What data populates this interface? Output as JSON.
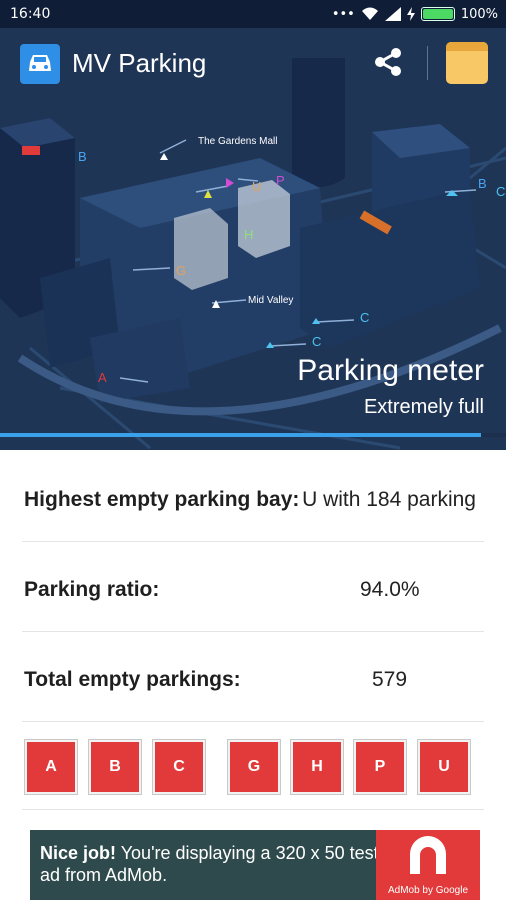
{
  "status_bar": {
    "time": "16:40",
    "icons": [
      "dots-icon",
      "wifi-icon",
      "signal-icon",
      "charging-icon",
      "battery-icon"
    ],
    "battery_percent": "100%"
  },
  "app_bar": {
    "title": "MV Parking",
    "app_icon": "car-icon",
    "actions": [
      "share-icon",
      "notes-icon"
    ]
  },
  "map": {
    "mall_labels": [
      "The Gardens Mall",
      "Mid Valley"
    ],
    "zone_labels": [
      {
        "id": "A",
        "color": "#e03a3a"
      },
      {
        "id": "B",
        "color": "#4aa3f0"
      },
      {
        "id": "B",
        "color": "#4aa3f0"
      },
      {
        "id": "C",
        "color": "#4cc3f0"
      },
      {
        "id": "C",
        "color": "#4cc3f0"
      },
      {
        "id": "C",
        "color": "#4cc3f0"
      },
      {
        "id": "G",
        "color": "#e2a15a"
      },
      {
        "id": "H",
        "color": "#8fe07a"
      },
      {
        "id": "P",
        "color": "#d24cd6"
      },
      {
        "id": "U",
        "color": "#e2a15a"
      }
    ]
  },
  "meter": {
    "title": "Parking meter",
    "status": "Extremely full",
    "fill_ratio": 0.95
  },
  "stats": [
    {
      "label": "Highest empty parking bay:",
      "value": "U with 184 parking"
    },
    {
      "label": "Parking ratio:",
      "value": "94.0%"
    },
    {
      "label": "Total empty parkings:",
      "value": "579"
    }
  ],
  "lots": [
    "A",
    "B",
    "C",
    "G",
    "H",
    "P",
    "U"
  ],
  "ad": {
    "bold": "Nice job!",
    "text": " You're displaying a 320 x 50 test ad from AdMob.",
    "brand": "AdMob by Google"
  },
  "colors": {
    "accent": "#e23a3a",
    "map_bg": "#1f3556",
    "progress": "#3aa0ea"
  }
}
